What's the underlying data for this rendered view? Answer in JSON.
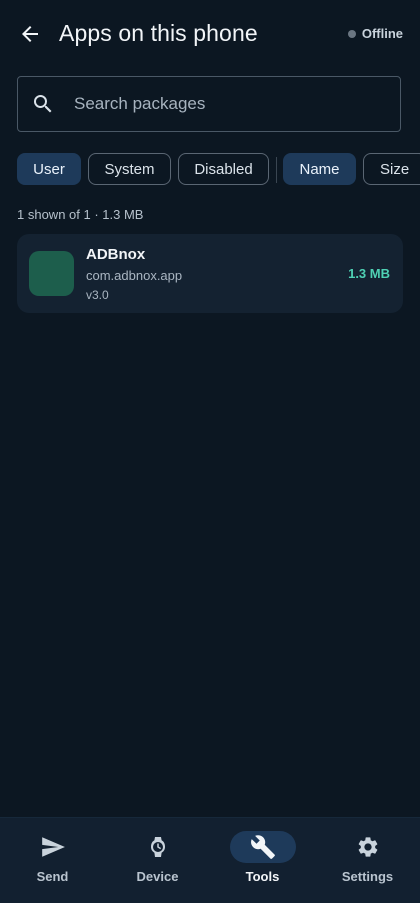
{
  "header": {
    "title": "Apps on this phone",
    "status": "Offline",
    "back_icon": "arrow-left-icon"
  },
  "search": {
    "placeholder": "Search packages",
    "value": ""
  },
  "filters": [
    {
      "label": "User",
      "selected": true
    },
    {
      "label": "System",
      "selected": false
    },
    {
      "label": "Disabled",
      "selected": false
    }
  ],
  "sort": [
    {
      "label": "Name",
      "selected": true
    },
    {
      "label": "Size",
      "selected": false
    }
  ],
  "summary": "1 shown of 1 · 1.3 MB",
  "apps": [
    {
      "name": "ADBnox",
      "package": "com.adbnox.app",
      "version": "v3.0",
      "size": "1.3 MB"
    }
  ],
  "nav": [
    {
      "label": "Send",
      "icon": "send-icon",
      "active": false
    },
    {
      "label": "Device",
      "icon": "watch-icon",
      "active": false
    },
    {
      "label": "Tools",
      "icon": "wrench-icon",
      "active": true
    },
    {
      "label": "Settings",
      "icon": "gear-icon",
      "active": false
    }
  ],
  "colors": {
    "background": "#0c1722",
    "accent": "#1e3a5a",
    "size_text": "#4fd1b4",
    "app_icon": "#1d5e4c"
  }
}
